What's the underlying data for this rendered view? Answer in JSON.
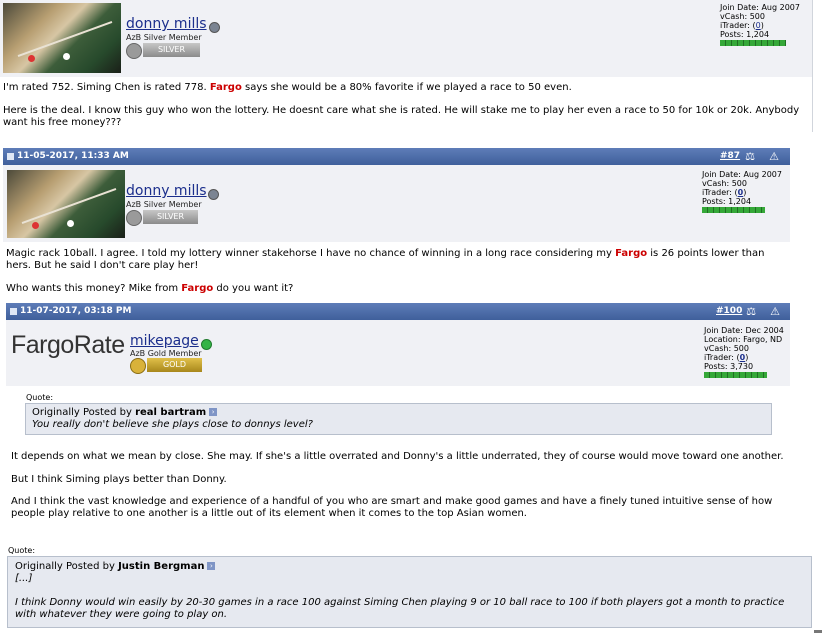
{
  "post1": {
    "username": "donny mills",
    "user_title": "AzB Silver Member",
    "rank": "SILVER",
    "stats": {
      "join_date": "Join Date: Aug 2007",
      "vcash": "vCash: 500",
      "itrader_label": "iTrader: (",
      "itrader_value": "0",
      "itrader_close": ")",
      "posts": "Posts: 1,204"
    },
    "line1_a": "I'm rated 752. Siming Chen is rated 778. ",
    "line1_fargo": "Fargo",
    "line1_b": " says she would be a 80% favorite if we played a race to 50 even.",
    "line2": "Here is the deal. I know this guy who won the lottery. He doesnt care what she is rated. He will stake me to play her even a race to 50 for 10k or 20k. Anybody want his free money???"
  },
  "post2": {
    "date": "11-05-2017, 11:33 AM",
    "number": "#87",
    "username": "donny mills",
    "user_title": "AzB Silver Member",
    "rank": "SILVER",
    "stats": {
      "join_date": "Join Date: Aug 2007",
      "vcash": "vCash: 500",
      "itrader_label": "iTrader: (",
      "itrader_value": "0",
      "itrader_close": ")",
      "posts": "Posts: 1,204"
    },
    "line1_a": "Magic rack 10ball. I agree. I told my lottery winner stakehorse I have no chance of winning in a long race considering my ",
    "line1_fargo": "Fargo",
    "line1_b": " is 26 points lower than hers. But he said I don't care play her!",
    "line2_a": "Who wants this money? Mike from ",
    "line2_fargo": "Fargo",
    "line2_b": " do you want it?"
  },
  "post3": {
    "date": "11-07-2017, 03:18 PM",
    "number": "#100",
    "logo_text": "FargoRate",
    "username": "mikepage",
    "user_title": "AzB Gold Member",
    "rank": "GOLD",
    "stats": {
      "join_date": "Join Date: Dec 2004",
      "location": "Location: Fargo, ND",
      "vcash": "vCash: 500",
      "itrader_label": "iTrader: (",
      "itrader_value": "0",
      "itrader_close": ")",
      "posts": "Posts: 3,730"
    },
    "quote_label": "Quote:",
    "quote_by_prefix": "Originally Posted by ",
    "quote_author": "real bartram",
    "quote_text": "You really don't believe she plays close to donnys level?",
    "para1": "It depends on what we mean by close. She may. If she's a little overrated and Donny's a little underrated, they of course would move toward one another.",
    "para2": "But I think Siming plays better than Donny.",
    "para3": "And I think the vast knowledge and experience of a handful of you who are smart and make good games and have a finely tuned intuitive sense of how people play relative to one another is a little out of its element when it comes to the top Asian women."
  },
  "post4": {
    "quote_label": "Quote:",
    "quote_by_prefix": "Originally Posted by ",
    "quote_author": "Justin Bergman",
    "quote_ellipsis": "[...]",
    "quote_text": "I think Donny would win easily by 20-30 games in a race 100 against Siming Chen playing 9 or 10 ball race to 100 if both players got a month to practice with whatever they were going to play on."
  },
  "icons": {
    "document": "document-icon",
    "scales": "report-scales-icon",
    "warning": "warning-icon",
    "arrow": "view-post-arrow-icon"
  },
  "colors": {
    "header_bg": "#4a6aa8",
    "profile_bg": "#f0f1f5",
    "link": "#1b2e8c",
    "fargo_red": "#cc0000"
  }
}
